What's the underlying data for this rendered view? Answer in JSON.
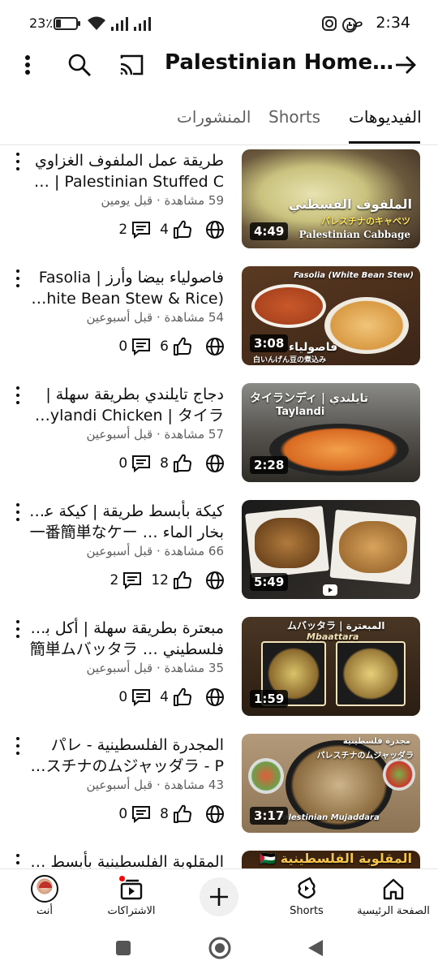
{
  "status_bar": {
    "time": "2:34",
    "ampm": "ص",
    "battery_pct": "23٪",
    "battery_level": 0.23
  },
  "app_bar": {
    "title": "Palestinian Home…",
    "back_icon": "arrow-right-icon",
    "cast_icon": "cast-icon",
    "search_icon": "search-icon",
    "more_icon": "more-vert-icon"
  },
  "tabs": [
    {
      "label": "الفيديوهات",
      "active": true
    },
    {
      "label": "Shorts",
      "active": false
    },
    {
      "label": "المنشورات",
      "active": false
    }
  ],
  "videos": [
    {
      "line1": "طريقة عمل الملفوف الغزاوي",
      "line2": "🇵🇸 | Palestinian Stuffed C…",
      "views": "59 مشاهدة",
      "age": "قبل يومين",
      "comments": "2",
      "likes": "4",
      "duration": "4:49",
      "thumb_caption_1": "الملفوف الفسطني",
      "thumb_caption_2": "パレスチナのキャベツ",
      "thumb_caption_3": "Palestinian Cabbage"
    },
    {
      "line1": "فاصولياء بيضا وأرز | Fasolia",
      "line2": "(White Bean Stew & Rice |…",
      "views": "54 مشاهدة",
      "age": "قبل أسبوعين",
      "comments": "0",
      "likes": "6",
      "duration": "3:08",
      "thumb_caption_1": "Fasolia (White Bean Stew)",
      "thumb_caption_2": "فاصولياء",
      "thumb_caption_3": "白いんげん豆の煮込み"
    },
    {
      "line1": "دجاج تايلندي بطريقة سهلة |",
      "line2": "Taylandi Chicken | タイラ…",
      "views": "57 مشاهدة",
      "age": "قبل أسبوعين",
      "comments": "0",
      "likes": "8",
      "duration": "2:28",
      "thumb_caption_1": "タイランディ | تايلندي",
      "thumb_caption_2": "Taylandi",
      "thumb_caption_3": ""
    },
    {
      "line1": "كيكة بأبسط طريقة | كيكة على",
      "line2": "بخار الماء … 一番簡単なケー",
      "views": "66 مشاهدة",
      "age": "قبل أسبوعين",
      "comments": "2",
      "likes": "12",
      "duration": "5:49",
      "thumb_caption_1": "",
      "thumb_caption_2": "",
      "thumb_caption_3": ""
    },
    {
      "line1": "مبعترة بطريقة سهلة | أكل بيتي",
      "line2": "فلسطيني … 簡単ムバッタラ",
      "views": "35 مشاهدة",
      "age": "قبل أسبوعين",
      "comments": "0",
      "likes": "4",
      "duration": "1:59",
      "thumb_caption_1": "ムバッタラ | المبعترة",
      "thumb_caption_2": "Mbaattara",
      "thumb_caption_3": ""
    },
    {
      "line1": "المجدرة الفلسطينية - パレ",
      "line2": "スチナのムジャッダラ - P…",
      "views": "43 مشاهدة",
      "age": "قبل أسبوعين",
      "comments": "0",
      "likes": "8",
      "duration": "3:17",
      "thumb_caption_1": "مجدرة فلسطينية",
      "thumb_caption_2": "パレスチナのムジャッダラ",
      "thumb_caption_3": "Palestinian Mujaddara"
    },
    {
      "line1": "المقلوبة الفلسطينية بأبسط طريقة",
      "line2": "",
      "views": "",
      "age": "",
      "comments": "",
      "likes": "",
      "duration": "",
      "thumb_caption_1": "🇵🇸 المقلوبة الفلسطينية",
      "thumb_caption_2": "",
      "thumb_caption_3": ""
    }
  ],
  "bottom_nav": [
    {
      "label": "الصفحة الرئيسية",
      "icon": "home-icon"
    },
    {
      "label": "Shorts",
      "icon": "shorts-icon"
    },
    {
      "label": "",
      "icon": "add-icon"
    },
    {
      "label": "الاشتراكات",
      "icon": "subscriptions-icon"
    },
    {
      "label": "أنت",
      "icon": "avatar-icon"
    }
  ],
  "colors": {
    "text_primary": "#0f0f0f",
    "text_secondary": "#606060",
    "notification_dot": "#ff0000"
  }
}
